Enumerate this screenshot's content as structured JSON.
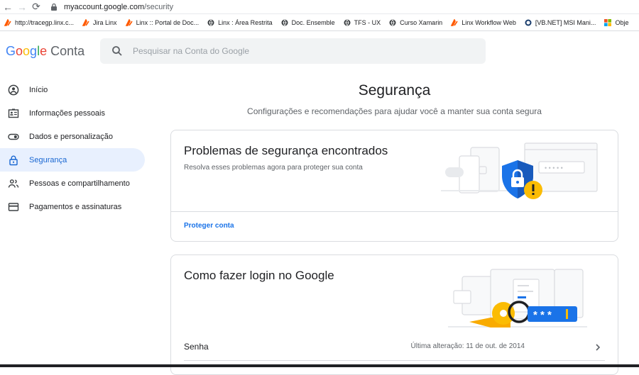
{
  "browser": {
    "url_host": "myaccount.google.com",
    "url_path": "/security",
    "bookmarks": [
      {
        "label": "http://tracegp.linx.c...",
        "icon": "linx-icon",
        "color": "#ff5a00"
      },
      {
        "label": "Jira Linx",
        "icon": "linx-icon",
        "color": "#ff5a00"
      },
      {
        "label": "Linx :: Portal de Doc...",
        "icon": "linx-icon",
        "color": "#ff5a00"
      },
      {
        "label": "Linx : Área Restrita",
        "icon": "globe-icon",
        "color": "#3c4043"
      },
      {
        "label": "Doc. Ensemble",
        "icon": "globe-icon",
        "color": "#3c4043"
      },
      {
        "label": "TFS - UX",
        "icon": "globe-icon",
        "color": "#3c4043"
      },
      {
        "label": "Curso Xamarin",
        "icon": "globe-icon",
        "color": "#3c4043"
      },
      {
        "label": "Linx Workflow Web",
        "icon": "linx-icon",
        "color": "#ff5a00"
      },
      {
        "label": "[VB.NET] MSI Mani...",
        "icon": "vbnet-icon",
        "color": "#3c4043"
      },
      {
        "label": "Obje",
        "icon": "microsoft-icon",
        "color": "#f25022"
      }
    ]
  },
  "header": {
    "logo_letters": [
      "G",
      "o",
      "o",
      "g",
      "l",
      "e"
    ],
    "logo_suffix": "Conta",
    "search_placeholder": "Pesquisar na Conta do Google"
  },
  "sidebar": {
    "items": [
      {
        "label": "Início",
        "icon": "account-circle-icon"
      },
      {
        "label": "Informações pessoais",
        "icon": "id-card-icon"
      },
      {
        "label": "Dados e personalização",
        "icon": "toggle-icon"
      },
      {
        "label": "Segurança",
        "icon": "lock-icon",
        "active": true
      },
      {
        "label": "Pessoas e compartilhamento",
        "icon": "people-icon"
      },
      {
        "label": "Pagamentos e assinaturas",
        "icon": "credit-card-icon"
      }
    ]
  },
  "main": {
    "title": "Segurança",
    "subtitle": "Configurações e recomendações para ajudar você a manter sua conta segura",
    "card_issues": {
      "title": "Problemas de segurança encontrados",
      "description": "Resolva esses problemas agora para proteger sua conta",
      "action": "Proteger conta"
    },
    "card_login": {
      "title": "Como fazer login no Google",
      "password_label": "Senha",
      "password_value": "Última alteração: 11 de out. de 2014"
    }
  },
  "colors": {
    "accent": "#1a73e8",
    "active_bg": "#e8f0fe",
    "warning": "#fbbc04",
    "shield": "#1a73e8",
    "key": "#f9ab00"
  }
}
